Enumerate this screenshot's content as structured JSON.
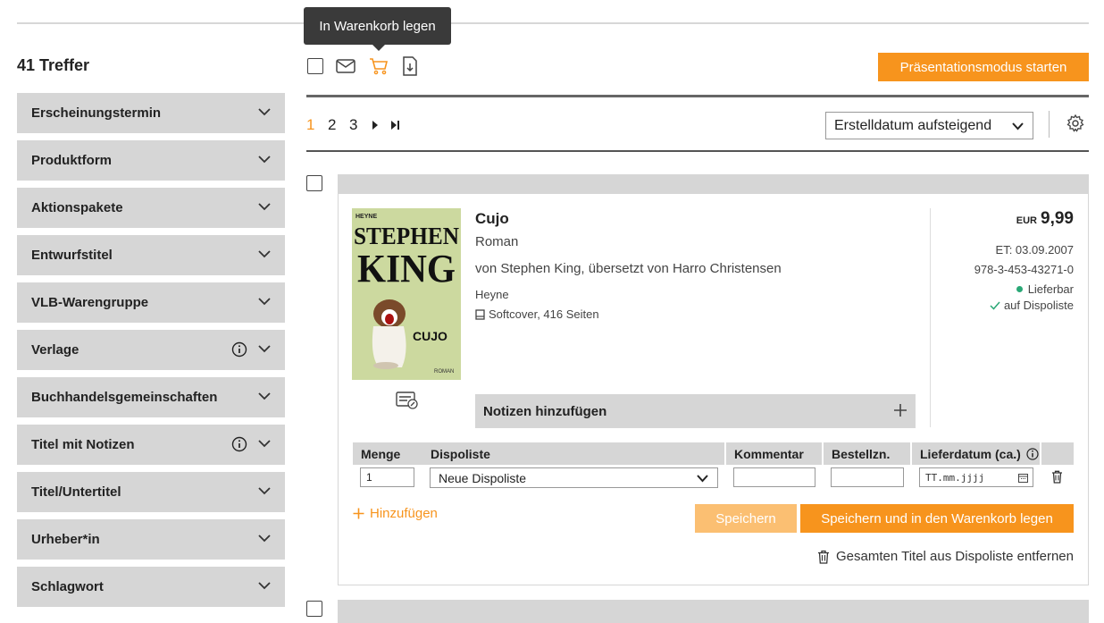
{
  "tooltip": {
    "text": "In Warenkorb legen"
  },
  "results": {
    "hits_label": "41 Treffer"
  },
  "facets": [
    {
      "label": "Erscheinungstermin",
      "info": false
    },
    {
      "label": "Produktform",
      "info": false
    },
    {
      "label": "Aktionspakete",
      "info": false
    },
    {
      "label": "Entwurfstitel",
      "info": false
    },
    {
      "label": "VLB-Warengruppe",
      "info": false
    },
    {
      "label": "Verlage",
      "info": true
    },
    {
      "label": "Buchhandelsgemeinschaften",
      "info": false
    },
    {
      "label": "Titel mit Notizen",
      "info": true
    },
    {
      "label": "Titel/Untertitel",
      "info": false
    },
    {
      "label": "Urheber*in",
      "info": false
    },
    {
      "label": "Schlagwort",
      "info": false
    }
  ],
  "toolbar": {
    "icons": [
      "select-all-checkbox",
      "mail-icon",
      "cart-icon",
      "download-icon"
    ],
    "presentation_button": "Präsentationsmodus starten"
  },
  "pagination": {
    "pages": [
      "1",
      "2",
      "3"
    ],
    "current": "1"
  },
  "sort": {
    "selected": "Erstelldatum aufsteigend"
  },
  "item": {
    "cover_texts": {
      "publisher": "HEYNE",
      "line1": "STEPHEN",
      "line2": "KING",
      "book": "CUJO",
      "kind": "ROMAN"
    },
    "title": "Cujo",
    "subtitle": "Roman",
    "authors": "von Stephen King, übersetzt von Harro Christensen",
    "publisher": "Heyne",
    "format": "Softcover, 416 Seiten",
    "currency": "EUR",
    "price": "9,99",
    "release": "ET: 03.09.2007",
    "isbn": "978-3-453-43271-0",
    "availability": "Lieferbar",
    "dispo_status": "auf Dispoliste",
    "notes_label": "Notizen hinzufügen"
  },
  "order_table": {
    "headers": {
      "menge": "Menge",
      "dispoliste": "Dispoliste",
      "kommentar": "Kommentar",
      "bestellnr": "Bestellzn.",
      "lieferdatum": "Lieferdatum (ca.)"
    },
    "row": {
      "menge": "1",
      "dispoliste": "Neue Dispoliste",
      "kommentar": "",
      "bestellnr": "",
      "lieferdatum_placeholder": "TT.mm.jjjj"
    },
    "add_label": "Hinzufügen",
    "save_label": "Speichern",
    "save_cart_label": "Speichern und in den Warenkorb legen",
    "remove_label": "Gesamten Titel aus Dispoliste entfernen"
  },
  "colors": {
    "accent": "#f7941d",
    "accent_light": "#fbbf72",
    "facet_bg": "#d6d6d6",
    "available": "#2aa876"
  }
}
